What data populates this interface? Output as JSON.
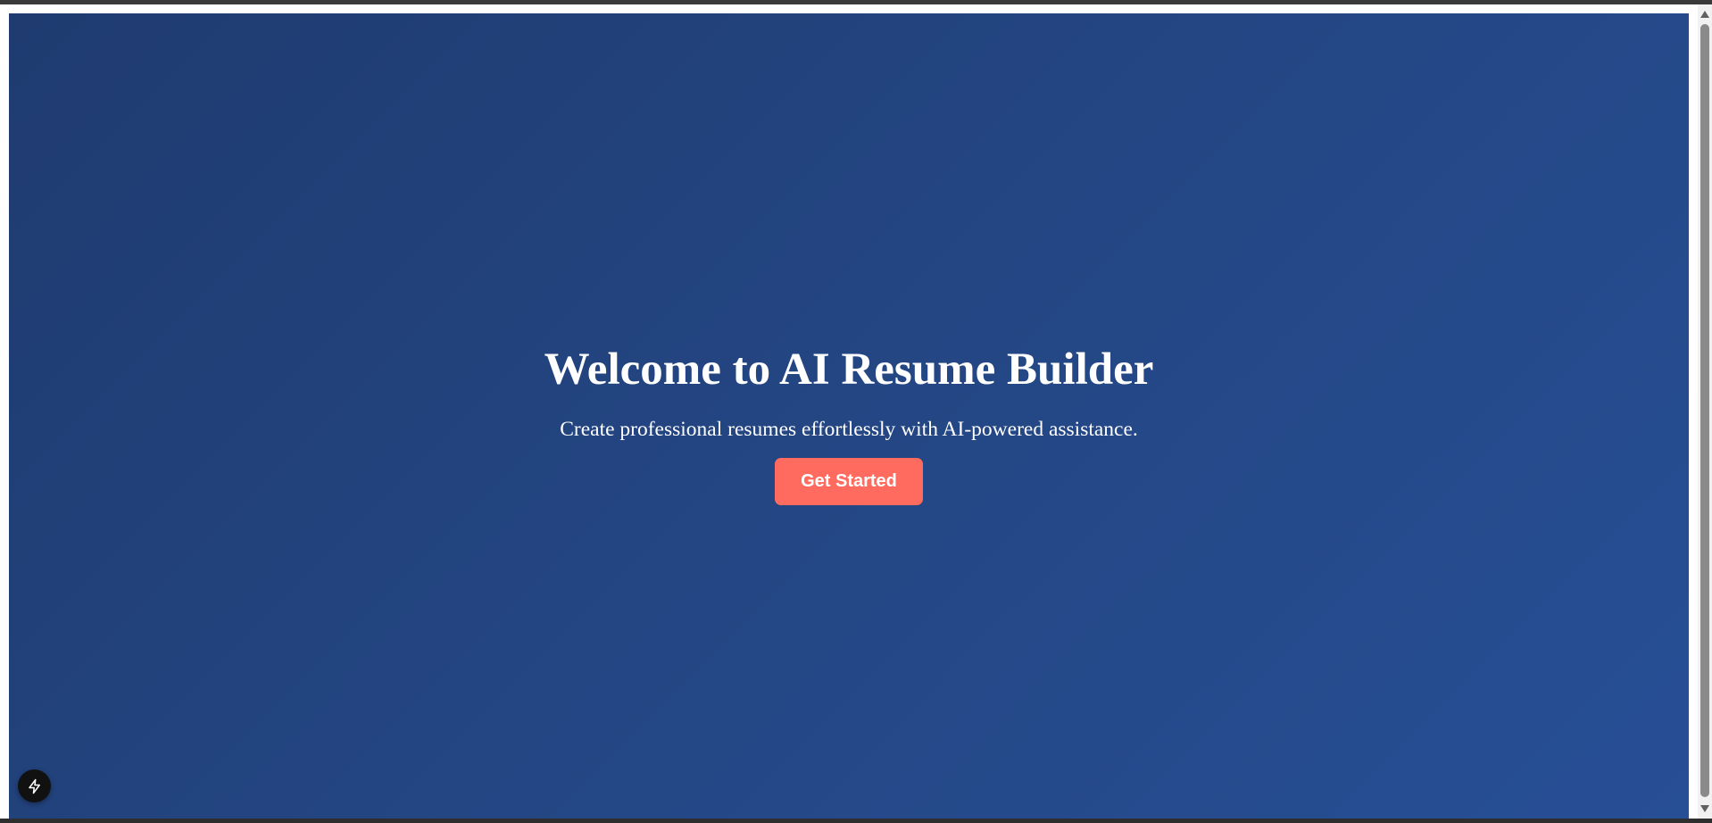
{
  "hero": {
    "title": "Welcome to AI Resume Builder",
    "subtitle": "Create professional resumes effortlessly with AI-powered assistance.",
    "cta_label": "Get Started"
  },
  "dev_badge": {
    "icon": "lightning-icon"
  },
  "scrollbar": {
    "up_icon": "triangle-up-icon",
    "down_icon": "triangle-down-icon"
  },
  "colors": {
    "hero_gradient_start": "#1f3b70",
    "hero_gradient_end": "#274f96",
    "cta_background": "#ff6b5e",
    "text": "#ffffff",
    "badge_background": "#111111"
  }
}
